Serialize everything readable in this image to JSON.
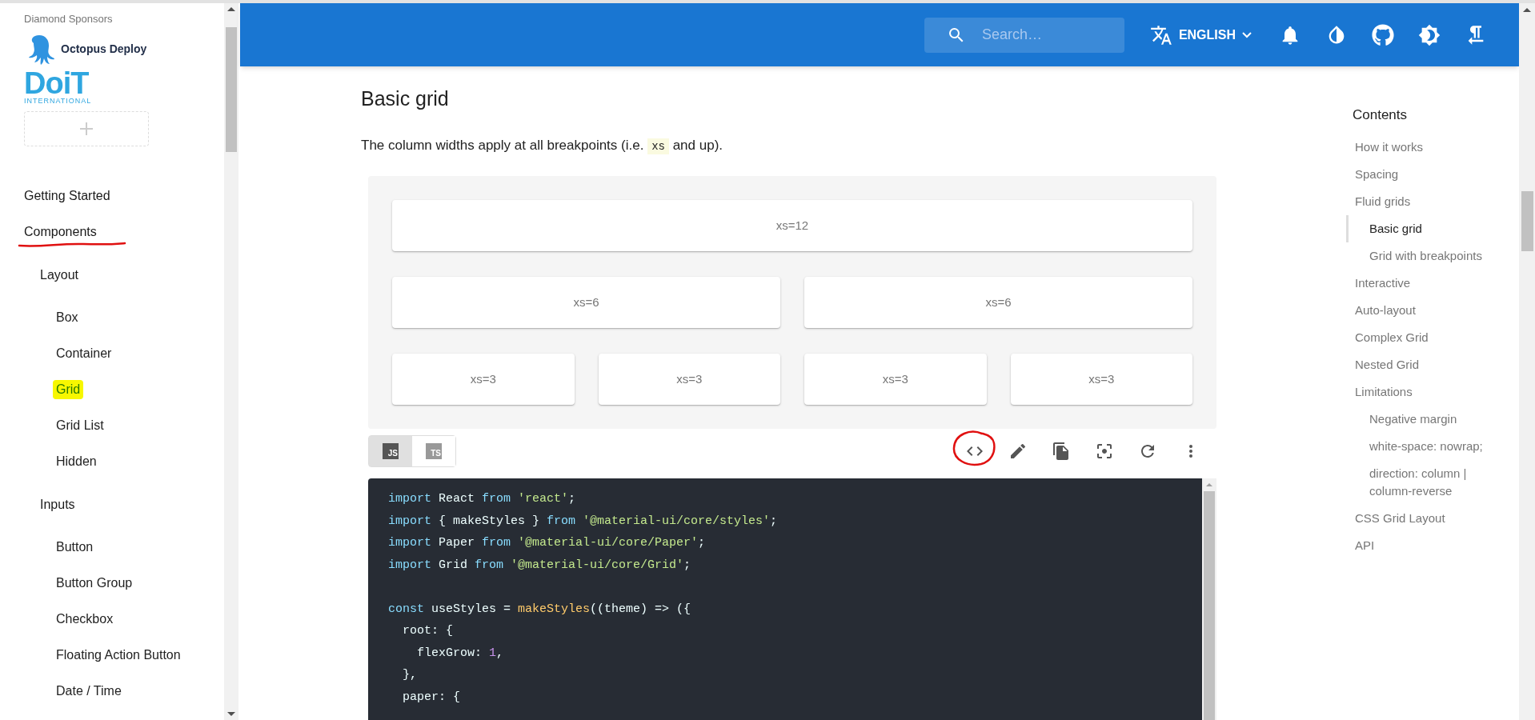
{
  "sidebar": {
    "sponsors_heading": "Diamond Sponsors",
    "sponsors": [
      {
        "kind": "octopus",
        "name": "Octopus Deploy"
      },
      {
        "kind": "doit",
        "name": "DoiT",
        "subtitle": "INTERNATIONAL"
      }
    ],
    "sections": [
      {
        "label": "Getting Started",
        "underlined": false
      },
      {
        "label": "Components",
        "underlined": true,
        "groups": [
          {
            "label": "Layout",
            "items": [
              {
                "label": "Box",
                "selected": false
              },
              {
                "label": "Container",
                "selected": false
              },
              {
                "label": "Grid",
                "selected": true
              },
              {
                "label": "Grid List",
                "selected": false
              },
              {
                "label": "Hidden",
                "selected": false
              }
            ]
          },
          {
            "label": "Inputs",
            "items": [
              {
                "label": "Button",
                "selected": false
              },
              {
                "label": "Button Group",
                "selected": false
              },
              {
                "label": "Checkbox",
                "selected": false
              },
              {
                "label": "Floating Action Button",
                "selected": false
              },
              {
                "label": "Date / Time",
                "selected": false
              }
            ]
          }
        ]
      }
    ]
  },
  "header": {
    "search": {
      "placeholder": "Search…"
    },
    "language": "ENGLISH"
  },
  "content": {
    "title": "Basic grid",
    "intro_before": "The column widths apply at all breakpoints (i.e. ",
    "intro_code": "xs",
    "intro_after": " and up).",
    "grid_rows": [
      [
        "xs=12"
      ],
      [
        "xs=6",
        "xs=6"
      ],
      [
        "xs=3",
        "xs=3",
        "xs=3",
        "xs=3"
      ]
    ],
    "lang_tabs": [
      {
        "label": "JS",
        "selected": true
      },
      {
        "label": "TS",
        "selected": false
      }
    ],
    "toolbar": [
      {
        "kind": "code",
        "circled": true
      },
      {
        "kind": "edit",
        "circled": false
      },
      {
        "kind": "copy",
        "circled": false
      },
      {
        "kind": "focus",
        "circled": false
      },
      {
        "kind": "refresh",
        "circled": false
      },
      {
        "kind": "more",
        "circled": false
      }
    ],
    "code_lines": [
      {
        "kind": "code",
        "tokens": [
          {
            "kind": "kw",
            "t": "import"
          },
          {
            "kind": "p",
            "t": " React "
          },
          {
            "kind": "kw",
            "t": "from "
          },
          {
            "kind": "str",
            "t": "'react'"
          },
          {
            "kind": "p",
            "t": ";"
          }
        ]
      },
      {
        "kind": "code",
        "tokens": [
          {
            "kind": "kw",
            "t": "import"
          },
          {
            "kind": "p",
            "t": " { makeStyles } "
          },
          {
            "kind": "kw",
            "t": "from "
          },
          {
            "kind": "str",
            "t": "'@material-ui/core/styles'"
          },
          {
            "kind": "p",
            "t": ";"
          }
        ]
      },
      {
        "kind": "code",
        "tokens": [
          {
            "kind": "kw",
            "t": "import"
          },
          {
            "kind": "p",
            "t": " Paper "
          },
          {
            "kind": "kw",
            "t": "from "
          },
          {
            "kind": "str",
            "t": "'@material-ui/core/Paper'"
          },
          {
            "kind": "p",
            "t": ";"
          }
        ]
      },
      {
        "kind": "code",
        "tokens": [
          {
            "kind": "kw",
            "t": "import"
          },
          {
            "kind": "p",
            "t": " Grid "
          },
          {
            "kind": "kw",
            "t": "from "
          },
          {
            "kind": "str",
            "t": "'@material-ui/core/Grid'"
          },
          {
            "kind": "p",
            "t": ";"
          }
        ]
      },
      {
        "kind": "blank"
      },
      {
        "kind": "code",
        "tokens": [
          {
            "kind": "kw",
            "t": "const"
          },
          {
            "kind": "p",
            "t": " useStyles = "
          },
          {
            "kind": "fn",
            "t": "makeStyles"
          },
          {
            "kind": "p",
            "t": "((theme) => ({"
          }
        ]
      },
      {
        "kind": "code",
        "tokens": [
          {
            "kind": "p",
            "t": "  root: {"
          }
        ]
      },
      {
        "kind": "code",
        "tokens": [
          {
            "kind": "p",
            "t": "    flexGrow: "
          },
          {
            "kind": "num",
            "t": "1"
          },
          {
            "kind": "p",
            "t": ","
          }
        ]
      },
      {
        "kind": "code",
        "tokens": [
          {
            "kind": "p",
            "t": "  },"
          }
        ]
      },
      {
        "kind": "code",
        "tokens": [
          {
            "kind": "p",
            "t": "  paper: {"
          }
        ]
      }
    ]
  },
  "toc": {
    "title": "Contents",
    "items": [
      {
        "label": "How it works",
        "selected": false
      },
      {
        "label": "Spacing",
        "selected": false
      },
      {
        "label": "Fluid grids",
        "selected": false,
        "children": [
          {
            "label": "Basic grid",
            "selected": true
          },
          {
            "label": "Grid with breakpoints",
            "selected": false
          }
        ]
      },
      {
        "label": "Interactive",
        "selected": false
      },
      {
        "label": "Auto-layout",
        "selected": false
      },
      {
        "label": "Complex Grid",
        "selected": false
      },
      {
        "label": "Nested Grid",
        "selected": false
      },
      {
        "label": "Limitations",
        "selected": false,
        "children": [
          {
            "label": "Negative margin",
            "selected": false
          },
          {
            "label": "white-space: nowrap;",
            "selected": false
          },
          {
            "label": "direction: column | column-reverse",
            "selected": false
          }
        ]
      },
      {
        "label": "CSS Grid Layout",
        "selected": false
      },
      {
        "label": "API",
        "selected": false
      }
    ]
  }
}
